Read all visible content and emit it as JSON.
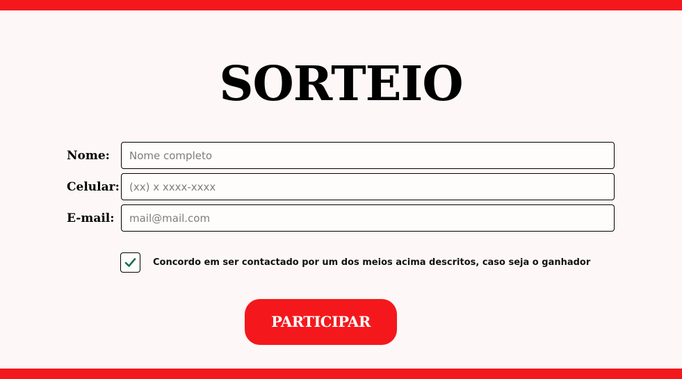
{
  "page": {
    "title": "SORTEIO"
  },
  "form": {
    "nome": {
      "label": "Nome:",
      "placeholder": "Nome completo",
      "value": ""
    },
    "celular": {
      "label": "Celular:",
      "placeholder": "(xx) x xxxx-xxxx",
      "value": ""
    },
    "email": {
      "label": "E-mail:",
      "placeholder": "mail@mail.com",
      "value": ""
    },
    "consent": {
      "checked": true,
      "text": "Concordo em ser contactado  por um dos meios acima descritos, caso seja o ganhador"
    },
    "submit_label": "PARTICIPAR"
  },
  "colors": {
    "accent": "#f4181c",
    "background": "#fdf8f7",
    "check": "#1b6e4e"
  },
  "icons": {
    "checkmark": "check-icon"
  }
}
